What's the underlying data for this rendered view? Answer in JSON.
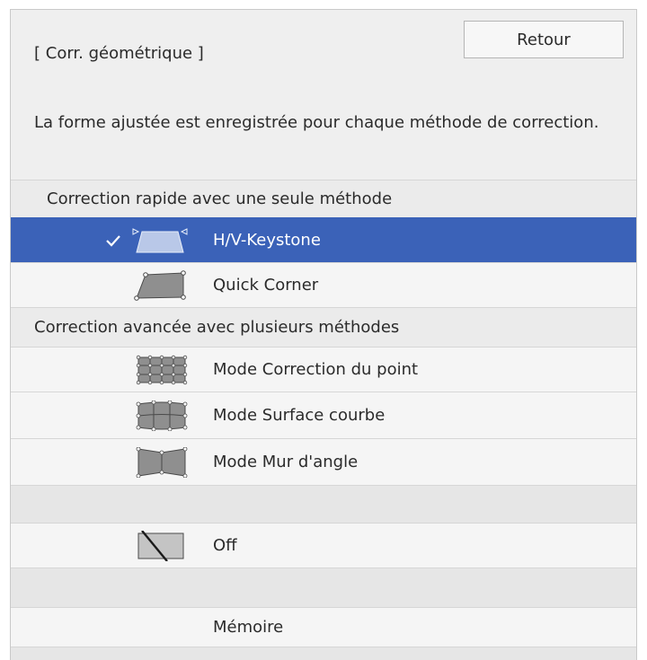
{
  "dialog": {
    "title": "[ Corr. géométrique ]",
    "back_label": "Retour",
    "info_text": "La forme ajustée est enregistrée pour chaque méthode de correction."
  },
  "sections": {
    "quick_header": "Correction rapide avec une seule méthode",
    "advanced_header": "Correction avancée avec plusieurs méthodes"
  },
  "items": {
    "hv_keystone": {
      "label": "H/V-Keystone",
      "icon": "hv-keystone-icon",
      "selected": true
    },
    "quick_corner": {
      "label": "Quick Corner",
      "icon": "quick-corner-icon"
    },
    "point_correction": {
      "label": "Mode Correction du point",
      "icon": "point-correction-icon"
    },
    "curved_surface": {
      "label": "Mode Surface courbe",
      "icon": "curved-surface-icon"
    },
    "corner_wall": {
      "label": "Mode Mur d'angle",
      "icon": "corner-wall-icon"
    },
    "off": {
      "label": "Off",
      "icon": "off-icon"
    },
    "memory": {
      "label": "Mémoire"
    }
  },
  "colors": {
    "selected_background": "#3b62b8",
    "panel_background": "#efefef"
  }
}
